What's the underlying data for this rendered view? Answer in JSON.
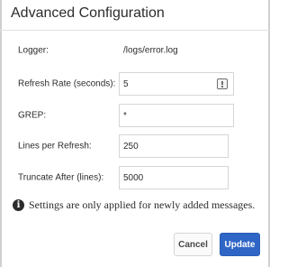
{
  "dialog": {
    "title": "Advanced Configuration"
  },
  "fields": {
    "logger": {
      "label": "Logger:",
      "value": "/logs/error.log"
    },
    "refresh_rate": {
      "label": "Refresh Rate (seconds):",
      "value": "5",
      "icon": "stepper-icon"
    },
    "grep": {
      "label": "GREP:",
      "value": "*"
    },
    "lines_per_refresh": {
      "label": "Lines per Refresh:",
      "value": "250"
    },
    "truncate_after": {
      "label": "Truncate After (lines):",
      "value": "5000"
    }
  },
  "note": {
    "icon": "info-icon",
    "icon_glyph": "i",
    "text": "Settings are only applied for newly added messages."
  },
  "buttons": {
    "cancel_label": "Cancel",
    "update_label": "Update"
  },
  "colors": {
    "primary": "#2f66c6",
    "border": "#d6d6d6",
    "text": "#2c2c2c"
  }
}
